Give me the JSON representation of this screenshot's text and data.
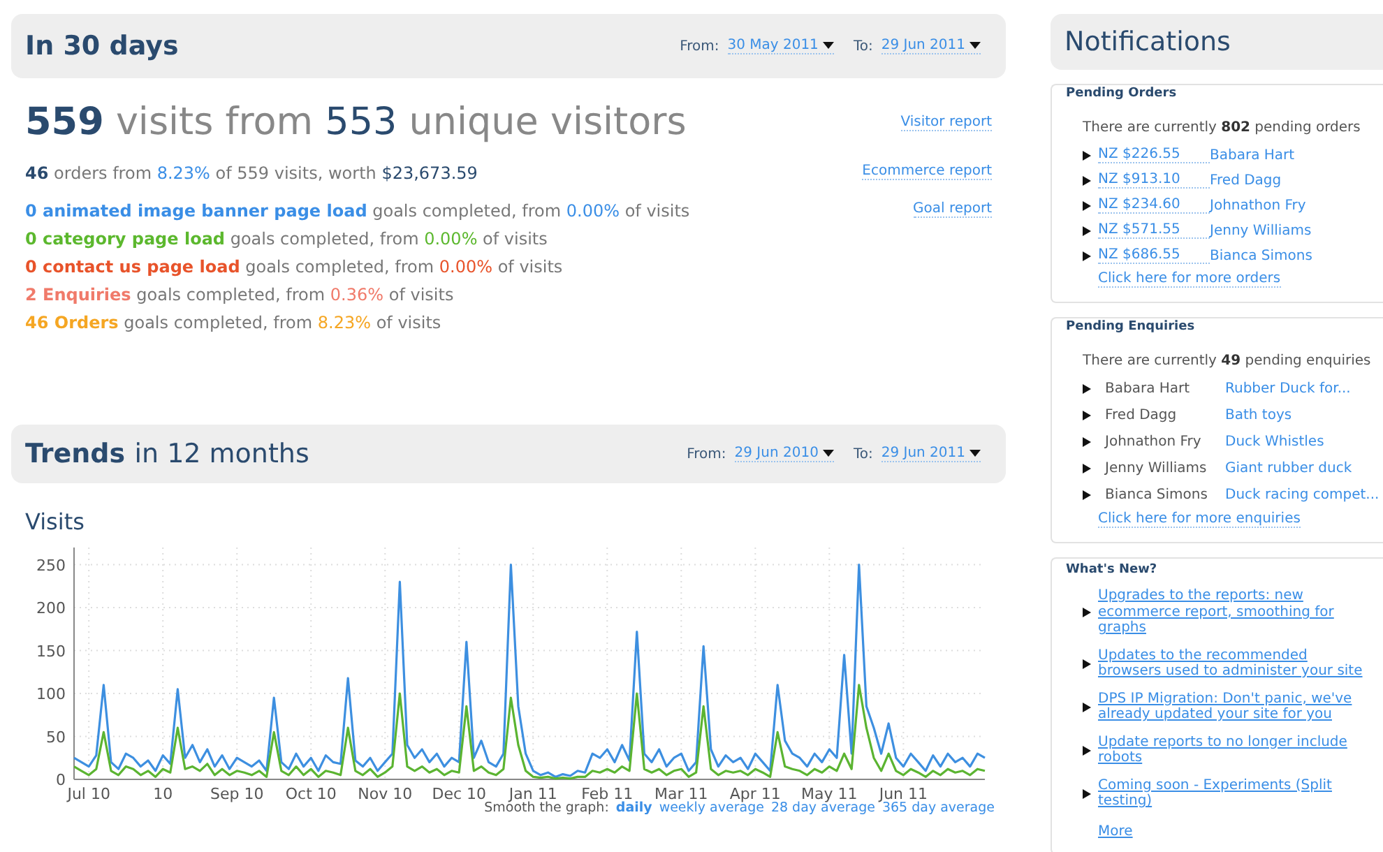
{
  "summary": {
    "title": "In 30 days",
    "from_label": "From:",
    "from_date": "30 May 2011",
    "to_label": "To:",
    "to_date": "29 Jun 2011"
  },
  "headline": {
    "visits": "559",
    "middle": "visits from",
    "unique": "553",
    "suffix": "unique visitors",
    "link": "Visitor report"
  },
  "orders_line": {
    "count": "46",
    "text_1": "orders from",
    "percent": "8.23%",
    "text_2": "of 559 visits, worth",
    "worth": "$23,673.59",
    "link": "Ecommerce report"
  },
  "goal_link": "Goal report",
  "goals": [
    {
      "name": "0 animated image banner page load",
      "middle": "goals completed, from",
      "percent": "0.00%",
      "suffix": "of visits",
      "color": "#3a8ee6"
    },
    {
      "name": "0 category page load",
      "middle": "goals completed, from",
      "percent": "0.00%",
      "suffix": "of visits",
      "color": "#5cb82e"
    },
    {
      "name": "0 contact us page load",
      "middle": "goals completed, from",
      "percent": "0.00%",
      "suffix": "of visits",
      "color": "#e8532a"
    },
    {
      "name": "2 Enquiries",
      "middle": "goals completed, from",
      "percent": "0.36%",
      "suffix": "of visits",
      "color": "#f07a6a"
    },
    {
      "name": "46 Orders",
      "middle": "goals completed, from",
      "percent": "8.23%",
      "suffix": "of visits",
      "color": "#f5a623"
    }
  ],
  "trends": {
    "title_bold": "Trends",
    "title_rest": "in 12 months",
    "from_label": "From:",
    "from_date": "29 Jun 2010",
    "to_label": "To:",
    "to_date": "29 Jun 2011",
    "chart_data": {
      "type": "line",
      "title": "Visits",
      "grid": true,
      "ylim": [
        0,
        270
      ],
      "yticks": [
        0,
        50,
        100,
        150,
        200,
        250
      ],
      "categories": [
        null,
        null,
        "Jul 10",
        null,
        null,
        null,
        null,
        null,
        null,
        null,
        null,
        null,
        "10",
        null,
        null,
        null,
        null,
        null,
        null,
        null,
        null,
        null,
        "Sep 10",
        null,
        null,
        null,
        null,
        null,
        null,
        null,
        null,
        null,
        "Oct 10",
        null,
        null,
        null,
        null,
        null,
        null,
        null,
        null,
        null,
        "Nov 10",
        null,
        null,
        null,
        null,
        null,
        null,
        null,
        null,
        null,
        "Dec 10",
        null,
        null,
        null,
        null,
        null,
        null,
        null,
        null,
        null,
        "Jan 11",
        null,
        null,
        null,
        null,
        null,
        null,
        null,
        null,
        null,
        "Feb 11",
        null,
        null,
        null,
        null,
        null,
        null,
        null,
        null,
        null,
        "Mar 11",
        null,
        null,
        null,
        null,
        null,
        null,
        null,
        null,
        null,
        "Apr 11",
        null,
        null,
        null,
        null,
        null,
        null,
        null,
        null,
        null,
        "May 11",
        null,
        null,
        null,
        null,
        null,
        null,
        null,
        null,
        null,
        "Jun 11",
        null,
        null,
        null,
        null,
        null,
        null,
        null,
        null,
        null,
        null,
        null
      ],
      "series": [
        {
          "color": "#3d8fe0",
          "values": [
            25,
            20,
            15,
            28,
            110,
            20,
            12,
            30,
            25,
            15,
            22,
            10,
            28,
            18,
            105,
            25,
            40,
            20,
            35,
            15,
            28,
            12,
            25,
            20,
            15,
            22,
            10,
            95,
            20,
            12,
            30,
            15,
            25,
            10,
            28,
            20,
            18,
            118,
            22,
            15,
            25,
            10,
            20,
            30,
            230,
            40,
            25,
            35,
            20,
            30,
            15,
            25,
            20,
            160,
            25,
            45,
            20,
            15,
            30,
            250,
            85,
            30,
            10,
            5,
            8,
            3,
            6,
            4,
            10,
            8,
            30,
            25,
            35,
            20,
            40,
            22,
            172,
            30,
            20,
            35,
            15,
            25,
            30,
            10,
            20,
            155,
            35,
            15,
            28,
            20,
            25,
            12,
            30,
            20,
            10,
            110,
            45,
            30,
            25,
            15,
            30,
            20,
            35,
            25,
            145,
            30,
            250,
            85,
            60,
            30,
            65,
            25,
            15,
            30,
            20,
            10,
            28,
            15,
            30,
            20,
            25,
            15,
            30,
            25
          ]
        },
        {
          "color": "#5bb431",
          "values": [
            15,
            10,
            5,
            12,
            55,
            10,
            5,
            15,
            12,
            5,
            10,
            3,
            12,
            8,
            60,
            12,
            15,
            10,
            18,
            5,
            12,
            5,
            10,
            8,
            5,
            10,
            3,
            55,
            10,
            5,
            15,
            5,
            12,
            3,
            10,
            8,
            5,
            60,
            10,
            5,
            12,
            3,
            8,
            15,
            100,
            15,
            10,
            15,
            8,
            12,
            5,
            10,
            8,
            85,
            10,
            15,
            8,
            5,
            12,
            95,
            40,
            10,
            3,
            2,
            3,
            1,
            2,
            1,
            3,
            3,
            10,
            8,
            12,
            8,
            15,
            10,
            100,
            12,
            8,
            12,
            5,
            10,
            12,
            3,
            8,
            85,
            12,
            5,
            10,
            8,
            10,
            5,
            12,
            8,
            3,
            55,
            15,
            12,
            10,
            5,
            12,
            8,
            15,
            10,
            30,
            12,
            110,
            60,
            25,
            10,
            30,
            10,
            5,
            12,
            8,
            3,
            10,
            5,
            12,
            8,
            10,
            5,
            12,
            10
          ]
        }
      ]
    },
    "smooth_label": "Smooth the graph:",
    "smooth_options": [
      {
        "label": "daily",
        "selected": true
      },
      {
        "label": "weekly average",
        "selected": false
      },
      {
        "label": "28 day average",
        "selected": false
      },
      {
        "label": "365 day average",
        "selected": false
      }
    ]
  },
  "notifications": {
    "title": "Notifications",
    "pending_orders": {
      "legend": "Pending Orders",
      "intro_1": "There are currently",
      "count": "802",
      "intro_2": "pending orders",
      "items": [
        {
          "amount": "NZ $226.55",
          "name": "Babara Hart"
        },
        {
          "amount": "NZ $913.10",
          "name": "Fred Dagg"
        },
        {
          "amount": "NZ $234.60",
          "name": "Johnathon Fry"
        },
        {
          "amount": "NZ $571.55",
          "name": "Jenny Williams"
        },
        {
          "amount": "NZ $686.55",
          "name": "Bianca Simons"
        }
      ],
      "more": "Click here for more orders"
    },
    "pending_enquiries": {
      "legend": "Pending Enquiries",
      "intro_1": "There are currently",
      "count": "49",
      "intro_2": "pending enquiries",
      "items": [
        {
          "name": "Babara Hart",
          "subject": "Rubber Duck for..."
        },
        {
          "name": "Fred Dagg",
          "subject": "Bath toys"
        },
        {
          "name": "Johnathon Fry",
          "subject": "Duck Whistles"
        },
        {
          "name": "Jenny Williams",
          "subject": "Giant rubber duck"
        },
        {
          "name": "Bianca Simons",
          "subject": "Duck racing compet..."
        }
      ],
      "more": "Click here for more enquiries"
    },
    "whats_new": {
      "legend": "What's New?",
      "items": [
        "Upgrades to the reports: new ecommerce report, smoothing for graphs",
        "Updates to the recommended browsers used to administer your site",
        "DPS IP Migration: Don't panic, we've already updated your site for you",
        "Update reports to no longer include robots",
        "Coming soon - Experiments (Split testing)"
      ],
      "more": "More"
    }
  }
}
